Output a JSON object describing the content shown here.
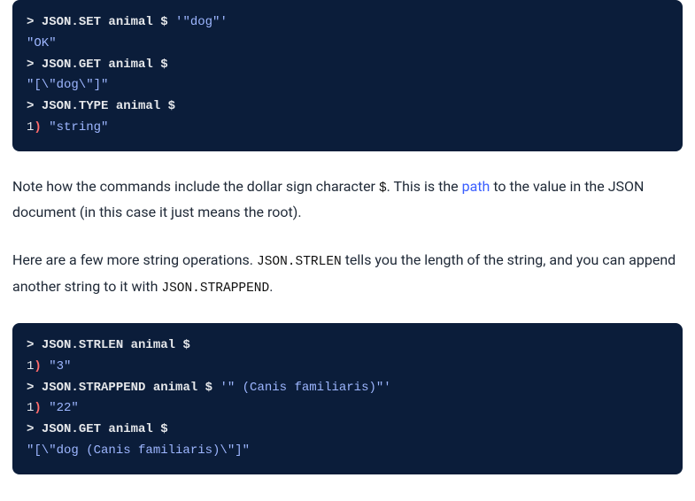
{
  "codeblock1": {
    "lines": [
      {
        "tokens": [
          {
            "cls": "tok-prompt",
            "t": "> "
          },
          {
            "cls": "tok-cmd",
            "t": "JSON.SET animal $ "
          },
          {
            "cls": "tok-lit",
            "t": "'\"dog\"'"
          }
        ]
      },
      {
        "tokens": [
          {
            "cls": "tok-out",
            "t": "\"OK\""
          }
        ]
      },
      {
        "tokens": [
          {
            "cls": "tok-prompt",
            "t": "> "
          },
          {
            "cls": "tok-cmd",
            "t": "JSON.GET animal $"
          }
        ]
      },
      {
        "tokens": [
          {
            "cls": "tok-out",
            "t": "\"[\\\"dog\\\"]\""
          }
        ]
      },
      {
        "tokens": [
          {
            "cls": "tok-prompt",
            "t": "> "
          },
          {
            "cls": "tok-cmd",
            "t": "JSON.TYPE animal $"
          }
        ]
      },
      {
        "tokens": [
          {
            "cls": "tok-num",
            "t": "1"
          },
          {
            "cls": "tok-paren",
            "t": ")"
          },
          {
            "cls": "tok-num",
            "t": " "
          },
          {
            "cls": "tok-str",
            "t": "\"string\""
          }
        ]
      }
    ]
  },
  "paragraph1": {
    "part1": "Note how the commands include the dollar sign character ",
    "code1": "$",
    "part2": ". This is the ",
    "link": "path",
    "part3": " to the value in the JSON document (in this case it just means the root)."
  },
  "paragraph2": {
    "part1": "Here are a few more string operations. ",
    "code1": "JSON.STRLEN",
    "part2": " tells you the length of the string, and you can append another string to it with ",
    "code2": "JSON.STRAPPEND",
    "part3": "."
  },
  "codeblock2": {
    "lines": [
      {
        "tokens": [
          {
            "cls": "tok-prompt",
            "t": "> "
          },
          {
            "cls": "tok-cmd",
            "t": "JSON.STRLEN animal $"
          }
        ]
      },
      {
        "tokens": [
          {
            "cls": "tok-num",
            "t": "1"
          },
          {
            "cls": "tok-paren",
            "t": ")"
          },
          {
            "cls": "tok-num",
            "t": " "
          },
          {
            "cls": "tok-str",
            "t": "\"3\""
          }
        ]
      },
      {
        "tokens": [
          {
            "cls": "tok-prompt",
            "t": "> "
          },
          {
            "cls": "tok-cmd",
            "t": "JSON.STRAPPEND animal $ "
          },
          {
            "cls": "tok-lit",
            "t": "'\" (Canis familiaris)\"'"
          }
        ]
      },
      {
        "tokens": [
          {
            "cls": "tok-num",
            "t": "1"
          },
          {
            "cls": "tok-paren",
            "t": ")"
          },
          {
            "cls": "tok-num",
            "t": " "
          },
          {
            "cls": "tok-str",
            "t": "\"22\""
          }
        ]
      },
      {
        "tokens": [
          {
            "cls": "tok-prompt",
            "t": "> "
          },
          {
            "cls": "tok-cmd",
            "t": "JSON.GET animal $"
          }
        ]
      },
      {
        "tokens": [
          {
            "cls": "tok-out",
            "t": "\"[\\\"dog (Canis familiaris)\\\"]\""
          }
        ]
      }
    ]
  }
}
